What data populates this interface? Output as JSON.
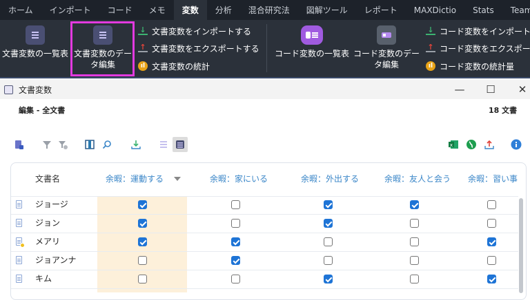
{
  "menu": {
    "tabs": [
      "ホーム",
      "インポート",
      "コード",
      "メモ",
      "変数",
      "分析",
      "混合研究法",
      "図解ツール",
      "レポート",
      "MAXDictio",
      "Stats",
      "TeamC"
    ],
    "active_index": 4
  },
  "ribbon": {
    "doc_vars_list": "文書変数の一覧表",
    "doc_vars_edit_line1": "文書変数のデー",
    "doc_vars_edit_line2": "タ編集",
    "doc_import": "文書変数をインポートする",
    "doc_export": "文書変数をエクスポートする",
    "doc_stats": "文書変数の統計",
    "code_vars_list": "コード変数の一覧表",
    "code_vars_edit_line1": "コード変数のデー",
    "code_vars_edit_line2": "タ編集",
    "code_import": "コード変数をインポート",
    "code_export": "コード変数をエクスポー",
    "code_stats": "コード変数の統計量"
  },
  "window": {
    "title": "文書変数",
    "minimize": "—",
    "maximize": "☐",
    "close": "✕"
  },
  "subheader": {
    "left": "編集 - 全文書",
    "right": "18 文書"
  },
  "table": {
    "name_header": "文書名",
    "columns": [
      "余暇：運動する",
      "余暇：家にいる",
      "余暇：外出する",
      "余暇：友人と会う",
      "余暇：習い事"
    ],
    "rows": [
      {
        "name": "ジョージ",
        "values": [
          true,
          false,
          true,
          true,
          false
        ],
        "memo": false
      },
      {
        "name": "ジョン",
        "values": [
          true,
          false,
          true,
          false,
          false
        ],
        "memo": false
      },
      {
        "name": "メアリ",
        "values": [
          true,
          true,
          false,
          false,
          true
        ],
        "memo": true
      },
      {
        "name": "ジョアンナ",
        "values": [
          false,
          true,
          false,
          false,
          false
        ],
        "memo": false
      },
      {
        "name": "キム",
        "values": [
          false,
          false,
          true,
          false,
          true
        ],
        "memo": false
      }
    ]
  },
  "icons": {
    "toolbar": [
      "document-filter-icon",
      "funnel-icon",
      "clear-filter-icon",
      "columns-icon",
      "search-icon",
      "import-icon",
      "doc-list-icon",
      "doc-edit-icon"
    ],
    "right": [
      "excel-icon",
      "globe-icon",
      "export-icon",
      "info-icon"
    ]
  },
  "colors": {
    "accent_blue": "#1e74d6",
    "highlight_box": "#e33ae0",
    "column_highlight": "#fdf0da"
  }
}
